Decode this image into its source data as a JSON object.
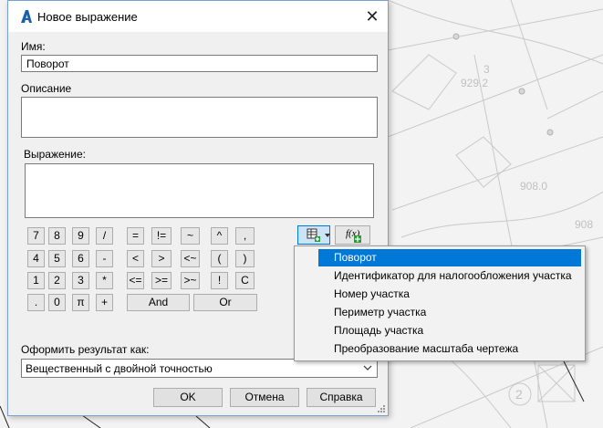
{
  "dialog": {
    "title": "Новое выражение",
    "close_glyph": "✕",
    "name_label": "Имя:",
    "name_value": "Поворот",
    "description_label": "Описание",
    "description_value": "",
    "expression_label": "Выражение:",
    "expression_value": "",
    "keypad": {
      "row1": [
        "7",
        "8",
        "9",
        "/",
        "=",
        "!=",
        "~",
        "^",
        ","
      ],
      "row2": [
        "4",
        "5",
        "6",
        "-",
        "<",
        ">",
        "<~",
        "(",
        ")"
      ],
      "row3": [
        "1",
        "2",
        "3",
        "*",
        "<=",
        ">=",
        ">~",
        "!",
        "C"
      ],
      "row4": [
        ".",
        "0",
        "π",
        "+",
        "And",
        "Or"
      ]
    },
    "fx_label": "f(x)",
    "format_label": "Оформить результат как:",
    "format_value": "Вещественный с двойной точностью",
    "ok_label": "OK",
    "cancel_label": "Отмена",
    "help_label": "Справка"
  },
  "property_menu": {
    "items": [
      "Поворот",
      "Идентификатор для налогообложения участка",
      "Номер участка",
      "Периметр участка",
      "Площадь участка",
      "Преобразование масштаба чертежа"
    ],
    "selected_index": 0
  },
  "background_drawing": {
    "labels": [
      "929.2",
      "3",
      "908.0",
      "908",
      "2"
    ]
  },
  "colors": {
    "accent": "#0078d7",
    "dialog_bg": "#f0f0f0",
    "icon_red": "#c0282f",
    "icon_green": "#2e9b3a"
  }
}
